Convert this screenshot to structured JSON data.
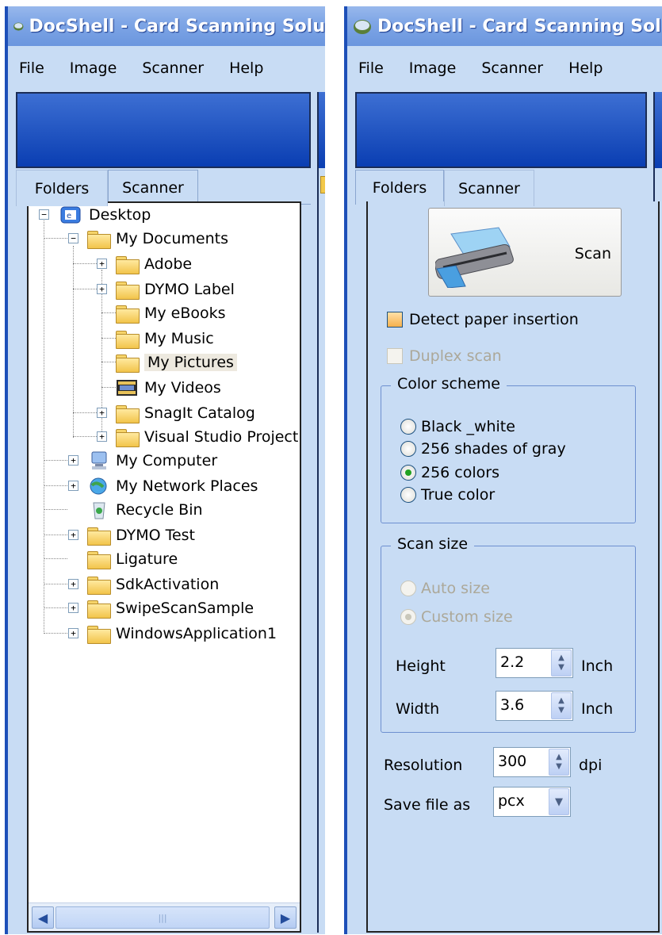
{
  "left_window": {
    "title": "DocShell - Card Scanning Solu",
    "menu": [
      "File",
      "Image",
      "Scanner",
      "Help"
    ],
    "tabs": {
      "folders": "Folders",
      "scanner": "Scanner"
    },
    "tree": [
      {
        "label": "Desktop"
      },
      {
        "label": "My Documents"
      },
      {
        "label": "Adobe"
      },
      {
        "label": "DYMO Label"
      },
      {
        "label": "My eBooks"
      },
      {
        "label": "My Music"
      },
      {
        "label": "My Pictures"
      },
      {
        "label": "My Videos"
      },
      {
        "label": "SnagIt Catalog"
      },
      {
        "label": "Visual Studio Project"
      },
      {
        "label": "My Computer"
      },
      {
        "label": "My Network Places"
      },
      {
        "label": "Recycle Bin"
      },
      {
        "label": "DYMO Test"
      },
      {
        "label": "Ligature"
      },
      {
        "label": "SdkActivation"
      },
      {
        "label": "SwipeScanSample"
      },
      {
        "label": "WindowsApplication1"
      }
    ],
    "selected_item": "My Pictures"
  },
  "right_window": {
    "title": "DocShell - Card Scanning Sol",
    "menu": [
      "File",
      "Image",
      "Scanner",
      "Help"
    ],
    "tabs": {
      "folders": "Folders",
      "scanner": "Scanner"
    },
    "scan_button": "Scan",
    "detect_paper": "Detect paper insertion",
    "duplex": "Duplex scan",
    "color_scheme": {
      "title": "Color scheme",
      "options": [
        "Black _white",
        "256 shades of gray",
        "256 colors",
        "True color"
      ],
      "selected": "256 colors"
    },
    "scan_size": {
      "title": "Scan size",
      "auto": "Auto size",
      "custom": "Custom size",
      "height_label": "Height",
      "height_value": "2.2",
      "height_unit": "Inch",
      "width_label": "Width",
      "width_value": "3.6",
      "width_unit": "Inch"
    },
    "resolution_label": "Resolution",
    "resolution_value": "300",
    "resolution_unit": "dpi",
    "save_as_label": "Save file as",
    "save_as_value": "pcx"
  },
  "colors": {
    "title_blue": "#7fa6e6",
    "panel_blue": "#0a3eb2",
    "bg": "#c8dcf4"
  }
}
